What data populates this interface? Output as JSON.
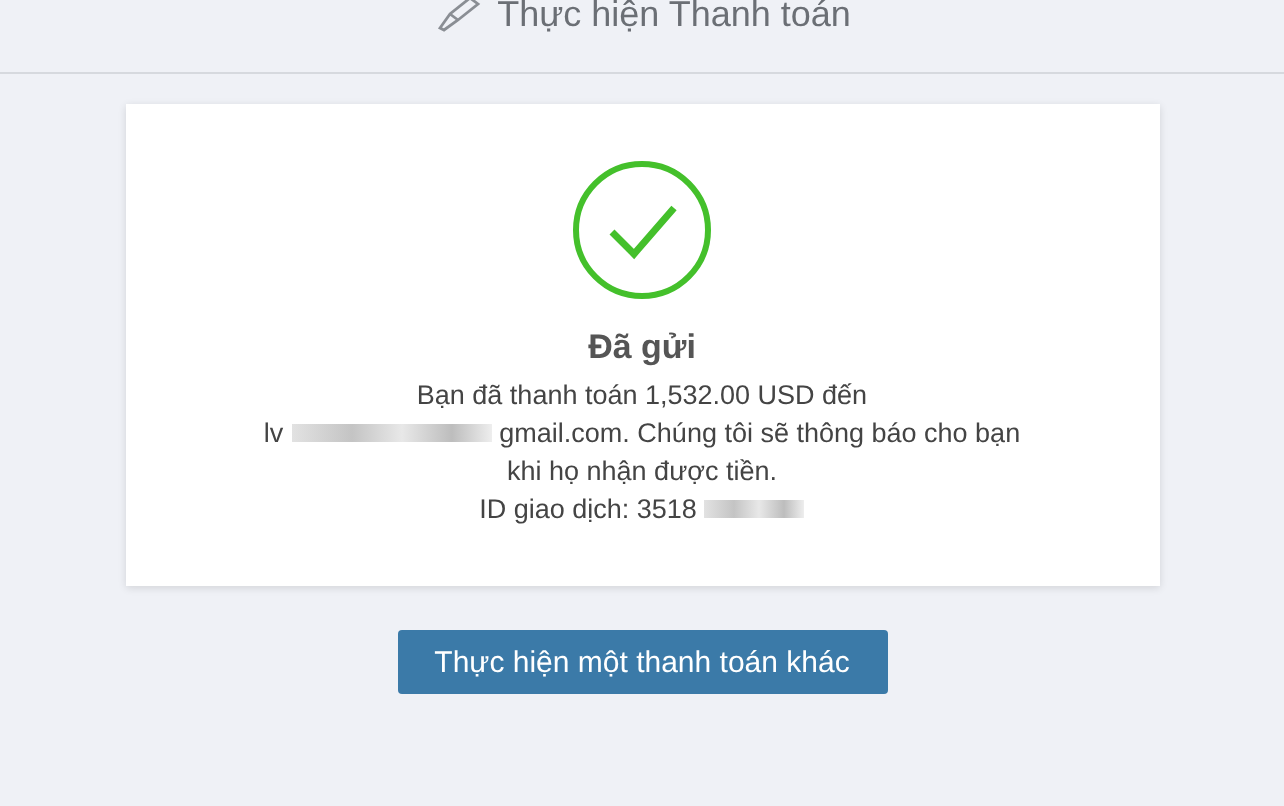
{
  "header": {
    "title": "Thực hiện Thanh toán"
  },
  "card": {
    "status": "Đã gửi",
    "lines": [
      {
        "kind": "text",
        "text": "Bạn đã thanh toán 1,532.00 USD đến"
      },
      {
        "kind": "redacted",
        "before": "lv",
        "after": "gmail.com. Chúng tôi sẽ thông báo cho bạn"
      },
      {
        "kind": "text",
        "text": "khi họ nhận được tiền."
      },
      {
        "kind": "redacted",
        "before": "ID giao dịch: 3518"
      }
    ]
  },
  "button": {
    "label": "Thực hiện một thanh toán khác"
  }
}
